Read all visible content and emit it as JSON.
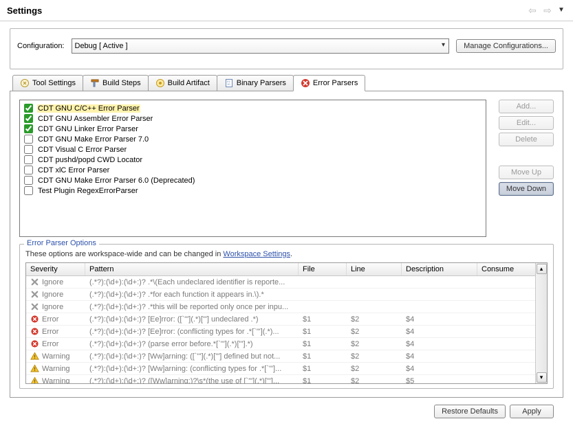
{
  "header": {
    "title": "Settings"
  },
  "config": {
    "label": "Configuration:",
    "selected": "Debug  [ Active ]",
    "manage_btn": "Manage Configurations..."
  },
  "tabs": [
    {
      "id": "tool-settings",
      "label": "Tool Settings",
      "icon": "wrench-gear"
    },
    {
      "id": "build-steps",
      "label": "Build Steps",
      "icon": "hammer-wrench"
    },
    {
      "id": "build-artifact",
      "label": "Build Artifact",
      "icon": "artifact"
    },
    {
      "id": "binary-parsers",
      "label": "Binary Parsers",
      "icon": "binary-doc"
    },
    {
      "id": "error-parsers",
      "label": "Error Parsers",
      "icon": "error-circle",
      "active": true
    }
  ],
  "parsers": [
    {
      "label": "CDT GNU C/C++ Error Parser",
      "checked": true,
      "selected": true
    },
    {
      "label": "CDT GNU Assembler Error Parser",
      "checked": true
    },
    {
      "label": "CDT GNU Linker Error Parser",
      "checked": true
    },
    {
      "label": "CDT GNU Make Error Parser 7.0",
      "checked": false
    },
    {
      "label": "CDT Visual C Error Parser",
      "checked": false
    },
    {
      "label": "CDT pushd/popd CWD Locator",
      "checked": false
    },
    {
      "label": "CDT xlC Error Parser",
      "checked": false
    },
    {
      "label": "CDT GNU Make Error Parser 6.0 (Deprecated)",
      "checked": false
    },
    {
      "label": "Test Plugin RegexErrorParser",
      "checked": false
    }
  ],
  "side_buttons": {
    "add": "Add...",
    "edit": "Edit...",
    "delete": "Delete",
    "move_up": "Move Up",
    "move_down": "Move Down"
  },
  "options": {
    "title": "Error Parser Options",
    "desc_pre": "These options are workspace-wide and can be changed in ",
    "desc_link": "Workspace Settings",
    "desc_post": "."
  },
  "columns": {
    "severity": "Severity",
    "pattern": "Pattern",
    "file": "File",
    "line": "Line",
    "description": "Description",
    "consume": "Consume"
  },
  "rows": [
    {
      "sev": "Ignore",
      "ico": "x",
      "pattern": "(.*?):(\\d+):(\\d+:)? .*\\(Each undeclared identifier is reporte...",
      "file": "",
      "line": "",
      "desc": "",
      "consume": ""
    },
    {
      "sev": "Ignore",
      "ico": "x",
      "pattern": "(.*?):(\\d+):(\\d+:)? .*for each function it appears in.\\).*",
      "file": "",
      "line": "",
      "desc": "",
      "consume": ""
    },
    {
      "sev": "Ignore",
      "ico": "x",
      "pattern": "(.*?):(\\d+):(\\d+:)? .*this will be reported only once per inpu...",
      "file": "",
      "line": "",
      "desc": "",
      "consume": ""
    },
    {
      "sev": "Error",
      "ico": "err",
      "pattern": "(.*?):(\\d+):(\\d+:)? [Ee]rror: ([`'\"](.*)['\"] undeclared .*)",
      "file": "$1",
      "line": "$2",
      "desc": "$4",
      "consume": ""
    },
    {
      "sev": "Error",
      "ico": "err",
      "pattern": "(.*?):(\\d+):(\\d+:)? [Ee]rror: (conflicting types for .*[`'\"](.*)...",
      "file": "$1",
      "line": "$2",
      "desc": "$4",
      "consume": ""
    },
    {
      "sev": "Error",
      "ico": "err",
      "pattern": "(.*?):(\\d+):(\\d+:)? (parse error before.*[`'\"](.*)['\"].*)",
      "file": "$1",
      "line": "$2",
      "desc": "$4",
      "consume": ""
    },
    {
      "sev": "Warning",
      "ico": "warn",
      "pattern": "(.*?):(\\d+):(\\d+:)? [Ww]arning: ([`'\"](.*)['\"] defined but not...",
      "file": "$1",
      "line": "$2",
      "desc": "$4",
      "consume": ""
    },
    {
      "sev": "Warning",
      "ico": "warn",
      "pattern": "(.*?):(\\d+):(\\d+:)? [Ww]arning: (conflicting types for .*[`'\"]...",
      "file": "$1",
      "line": "$2",
      "desc": "$4",
      "consume": ""
    },
    {
      "sev": "Warning",
      "ico": "warn",
      "pattern": "(.*?):(\\d+):(\\d+:)? ([Ww]arning:)?\\s*(the use of [`'\"](.*)['\"]...",
      "file": "$1",
      "line": "$2",
      "desc": "$5",
      "consume": ""
    }
  ],
  "footer": {
    "restore": "Restore Defaults",
    "apply": "Apply"
  }
}
